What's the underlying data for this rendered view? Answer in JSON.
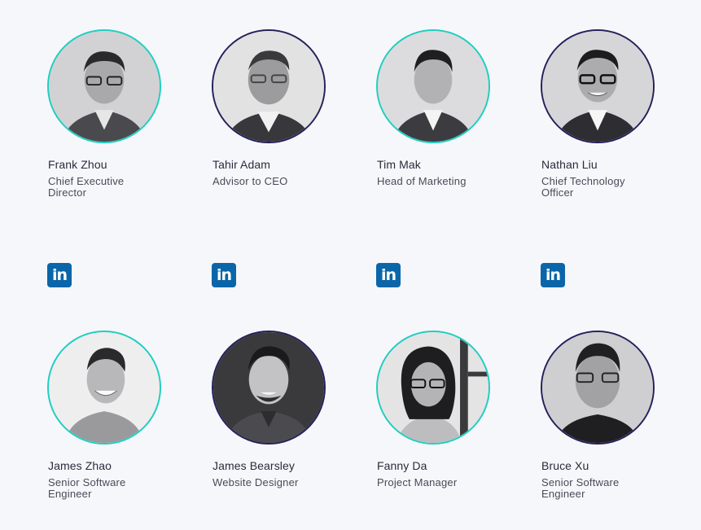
{
  "team": [
    {
      "name": "Frank Zhou",
      "role": "Chief Executive Director"
    },
    {
      "name": "Tahir Adam",
      "role": "Advisor to CEO"
    },
    {
      "name": "Tim Mak",
      "role": "Head of Marketing"
    },
    {
      "name": "Nathan Liu",
      "role": "Chief Technology Officer"
    },
    {
      "name": "James Zhao",
      "role": "Senior Software Engineer"
    },
    {
      "name": "James Bearsley",
      "role": "Website Designer"
    },
    {
      "name": "Fanny Da",
      "role": "Project Manager"
    },
    {
      "name": "Bruce Xu",
      "role": "Senior Software Engineer"
    }
  ],
  "linkedin": {
    "icon": "linkedin-icon",
    "label": "in"
  },
  "colors": {
    "background": "#f6f7fb",
    "ring_teal": "#1ecfc0",
    "ring_navy": "#26205a",
    "linkedin": "#0a66a8"
  }
}
